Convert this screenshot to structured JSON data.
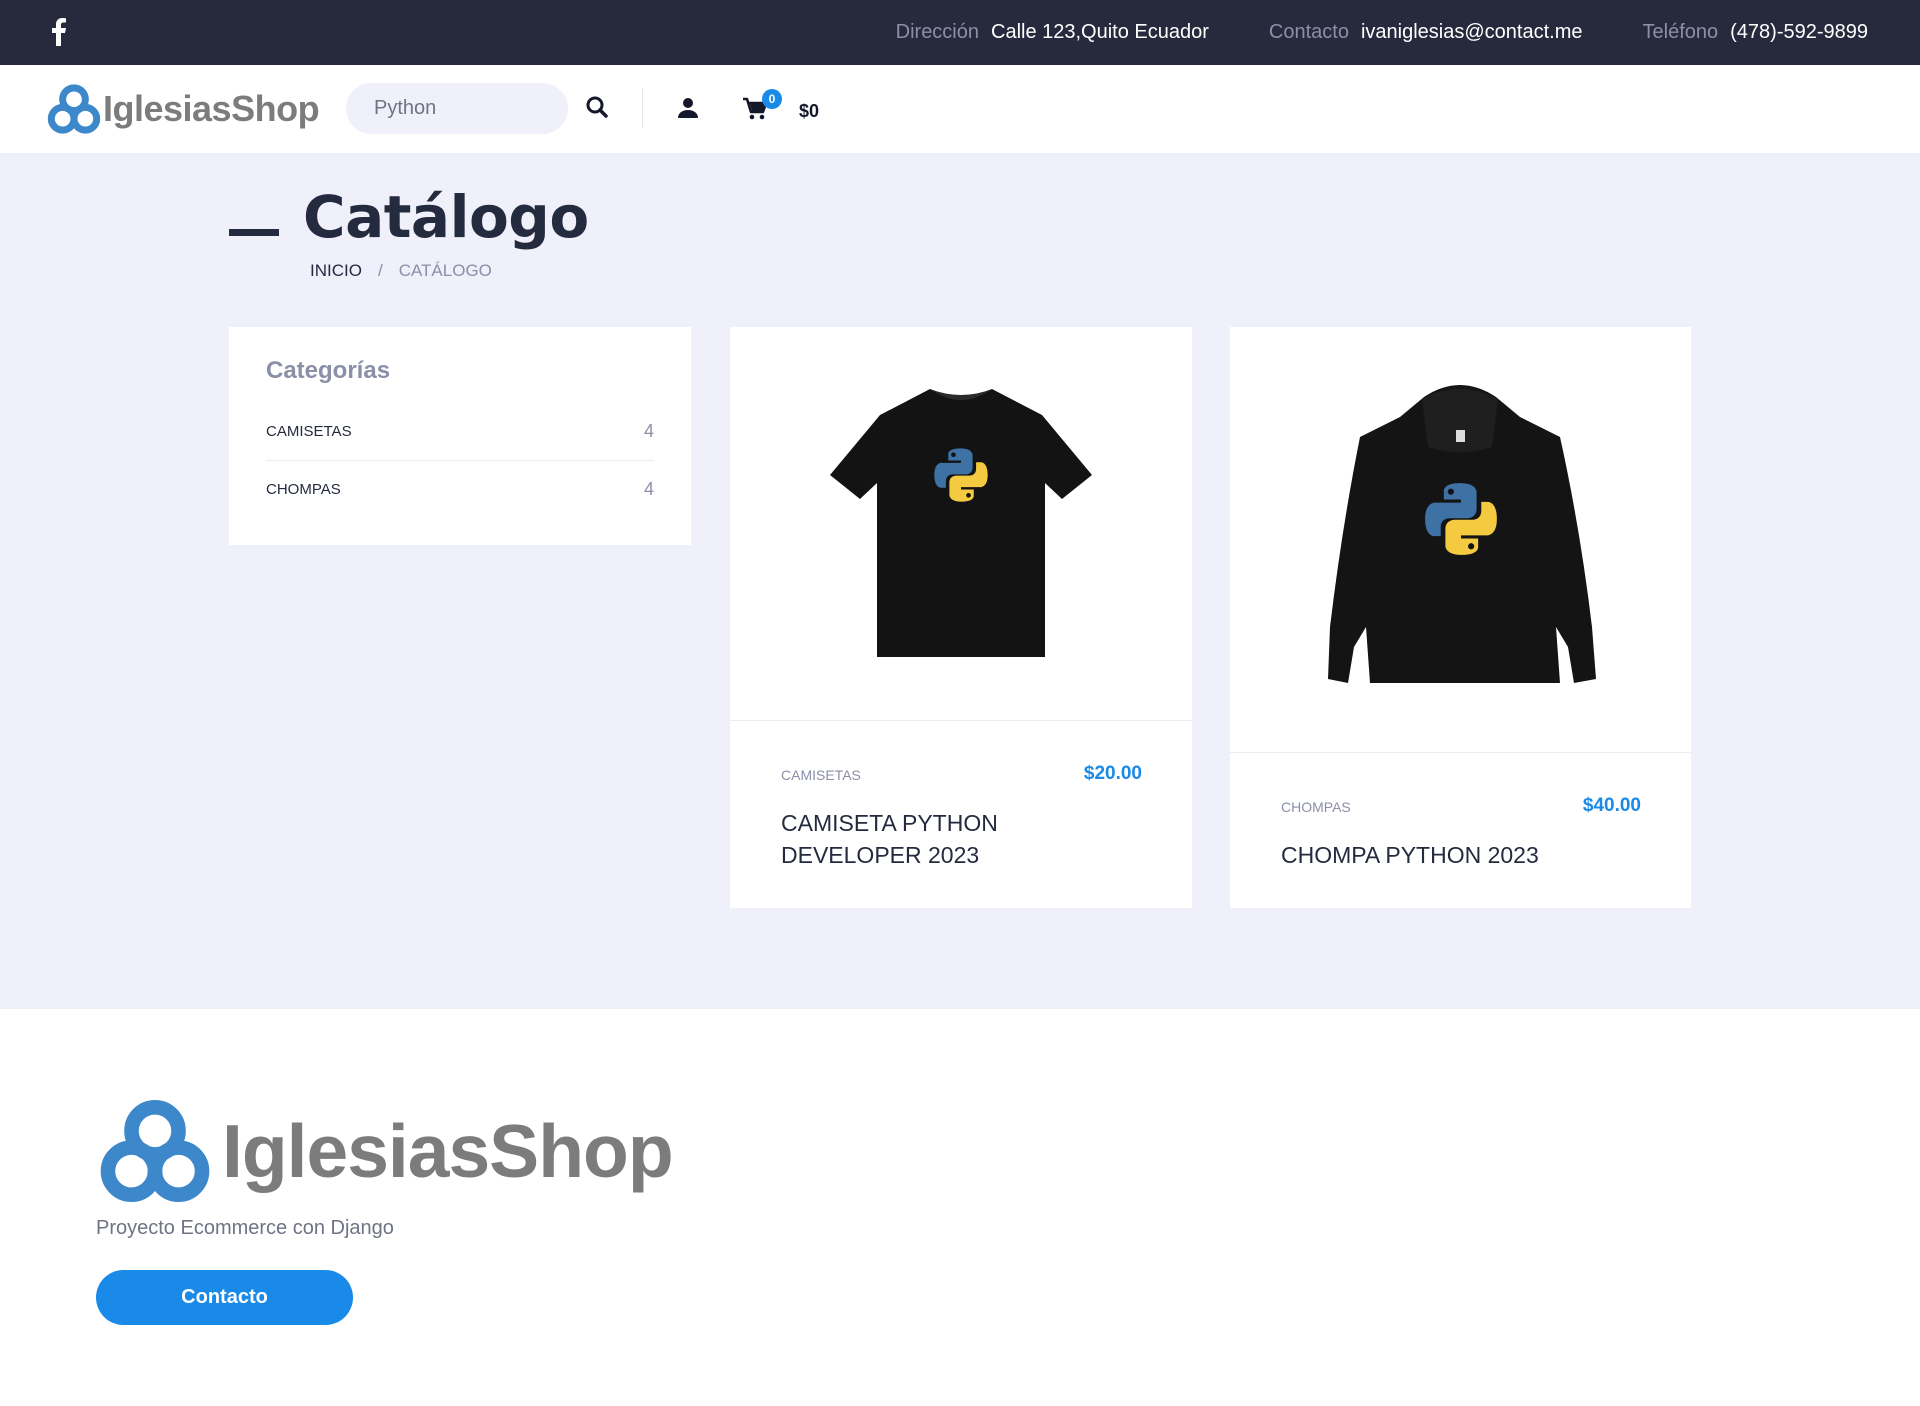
{
  "topbar": {
    "social_icon": "facebook-icon",
    "address_label": "Dirección",
    "address_value": "Calle 123,Quito Ecuador",
    "contact_label": "Contacto",
    "contact_value": "ivaniglesias@contact.me",
    "phone_label": "Teléfono",
    "phone_value": "(478)-592-9899"
  },
  "header": {
    "logo_text": "IglesiasShop",
    "search_value": "Python",
    "search_icon": "search-icon",
    "user_icon": "user-icon",
    "cart_icon": "cart-icon",
    "cart_count": "0",
    "cart_total": "$0"
  },
  "page": {
    "title": "Catálogo",
    "breadcrumb": {
      "home": "INICIO",
      "separator": "/",
      "current": "CATÁLOGO"
    }
  },
  "sidebar": {
    "title": "Categorías",
    "categories": [
      {
        "name": "CAMISETAS",
        "count": "4"
      },
      {
        "name": "CHOMPAS",
        "count": "4"
      }
    ]
  },
  "products": [
    {
      "category": "CAMISETAS",
      "price": "$20.00",
      "name": "CAMISETA PYTHON DEVELOPER 2023",
      "image": "black-tshirt-python-logo"
    },
    {
      "category": "CHOMPAS",
      "price": "$40.00",
      "name": "CHOMPA PYTHON 2023",
      "image": "black-hoodie-python-logo"
    }
  ],
  "footer": {
    "logo_text": "IglesiasShop",
    "tagline": "Proyecto Ecommerce con Django",
    "button_label": "Contacto"
  },
  "colors": {
    "topbar_bg": "#272a3d",
    "accent": "#1a8ae8",
    "main_bg": "#eff0fa",
    "text_dark": "#252b3f",
    "text_muted": "#8b8fa8",
    "logo_gray": "#7c7c7c",
    "logo_blue": "#3d87cb"
  }
}
